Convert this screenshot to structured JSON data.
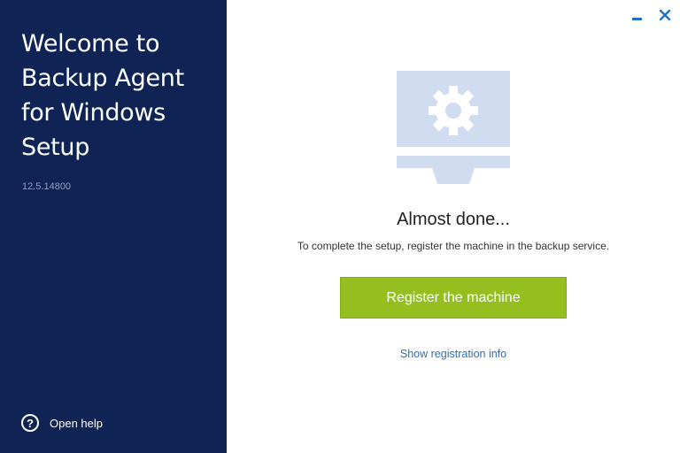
{
  "sidebar": {
    "title": "Welcome to Backup Agent for Windows Setup",
    "version": "12.5.14800",
    "help": {
      "label": "Open help",
      "icon": "question-circle-icon"
    }
  },
  "window_controls": {
    "minimize_icon": "minimize-icon",
    "close_icon": "close-icon"
  },
  "main": {
    "illustration_icon": "monitor-gear-icon",
    "heading": "Almost done...",
    "subtext": "To complete the setup, register the machine in the backup service.",
    "register_button": "Register the machine",
    "info_link": "Show registration info"
  },
  "colors": {
    "sidebar_bg": "#0f2454",
    "accent_green": "#94bf1f",
    "link_blue": "#2e6db4",
    "illustration": "#d0dcef"
  }
}
